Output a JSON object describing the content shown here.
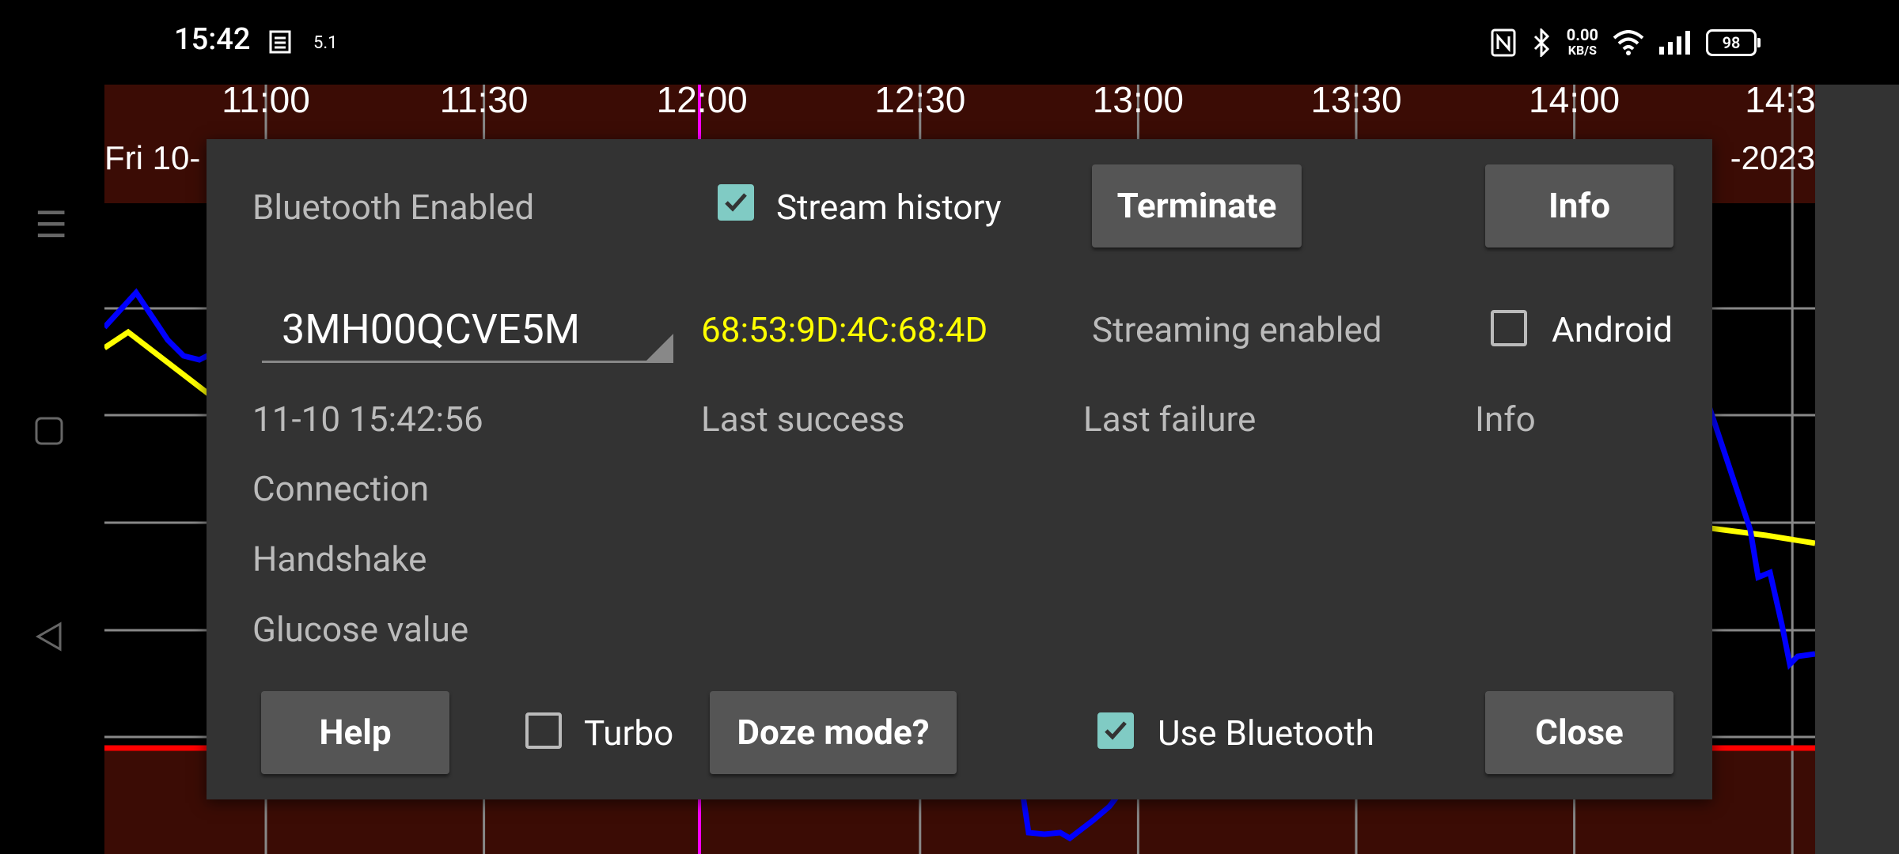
{
  "status_bar": {
    "time": "15:42",
    "small_text": "5.1",
    "speed_value": "0.00",
    "speed_unit": "KB/S",
    "battery": "98",
    "icons": [
      "nfc-icon",
      "bluetooth-icon",
      "wifi-icon",
      "signal-icon",
      "battery-icon"
    ]
  },
  "graph": {
    "time_labels": [
      "11:00",
      "11:30",
      "12:00",
      "12:30",
      "13:00",
      "13:30",
      "14:00",
      "14:3"
    ],
    "date_left": "Fri 10-",
    "date_right": "-2023",
    "colors": {
      "background_header": "#3b0c05",
      "current_line": "#ff00ff",
      "low_limit_line": "#ff0000",
      "series_blue": "#0000ff",
      "series_yellow": "#ffff00"
    }
  },
  "dialog": {
    "bluetooth_status": "Bluetooth Enabled",
    "stream_history": {
      "label": "Stream history",
      "checked": true
    },
    "terminate_button": "Terminate",
    "info_button": "Info",
    "sensor_selected": "3MH00QCVE5M",
    "mac_address": "68:53:9D:4C:68:4D",
    "streaming_status": "Streaming enabled",
    "android": {
      "label": "Android",
      "checked": false
    },
    "timestamp": "11-10 15:42:56",
    "col_last_success": "Last success",
    "col_last_failure": "Last failure",
    "col_info": "Info",
    "rows": [
      "Connection",
      "Handshake",
      "Glucose value"
    ],
    "help_button": "Help",
    "turbo": {
      "label": "Turbo",
      "checked": false
    },
    "doze_button": "Doze mode?",
    "use_bluetooth": {
      "label": "Use Bluetooth",
      "checked": true
    },
    "close_button": "Close",
    "colors": {
      "mac_text": "#ffff00",
      "checkbox_checked": "#80cbc4"
    }
  }
}
